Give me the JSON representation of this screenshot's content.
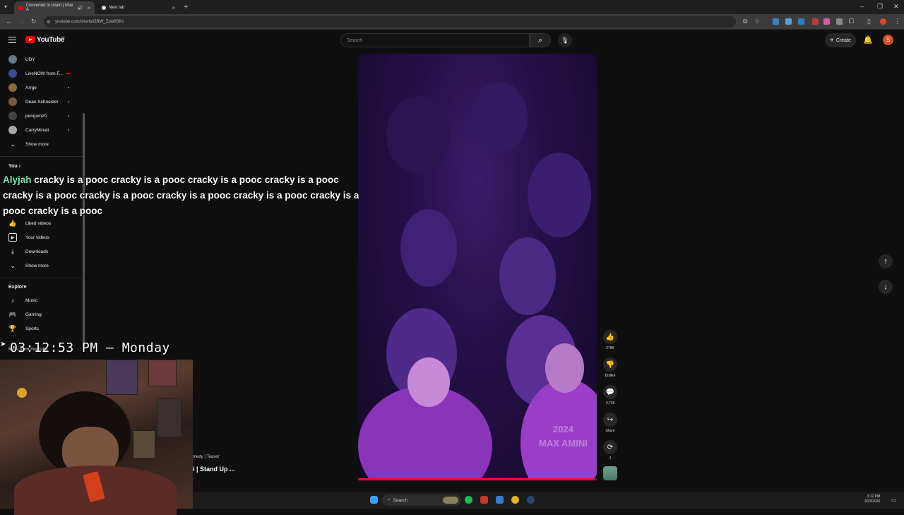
{
  "browser": {
    "tabs": [
      {
        "title": "Converted to Islam | Max A",
        "active": true
      },
      {
        "title": "New tab",
        "active": false
      }
    ],
    "url": "youtube.com/shorts/GBW_Zow0SKs"
  },
  "header": {
    "logo_text": "YouTube",
    "logo_sup": "SO",
    "search_placeholder": "Search",
    "create_label": "Create",
    "avatar_letter": "S"
  },
  "sidebar": {
    "subscriptions": [
      {
        "label": "UDY",
        "live": false,
        "dot": false
      },
      {
        "label": "LiveNOW from F...",
        "live": true,
        "dot": false
      },
      {
        "label": "Arrge",
        "live": false,
        "dot": true
      },
      {
        "label": "Dean Schneider",
        "live": false,
        "dot": true
      },
      {
        "label": "penguinz0",
        "live": false,
        "dot": true
      },
      {
        "label": "CarryMinati",
        "live": false,
        "dot": true
      }
    ],
    "show_more_1": "Show more",
    "you_heading": "You",
    "you_items": [
      {
        "label": "Liked videos",
        "icon": "thumb-up"
      },
      {
        "label": "Your videos",
        "icon": "play"
      },
      {
        "label": "Downloads",
        "icon": "download"
      }
    ],
    "show_more_2": "Show more",
    "explore_heading": "Explore",
    "explore_items": [
      {
        "label": "Music",
        "icon": "music"
      },
      {
        "label": "Gaming",
        "icon": "gaming"
      },
      {
        "label": "Sports",
        "icon": "trophy"
      }
    ],
    "more_heading": "More from YouTube"
  },
  "overlay": {
    "chat_user": "Alyjah",
    "chat_text": " cracky is a pooc cracky is a pooc cracky is a pooc cracky is a pooc cracky is a pooc cracky is a pooc cracky is a pooc cracky is a pooc cracky is a pooc cracky is a pooc",
    "clock": "03:12:53 PM — Monday",
    "teaser_line1": "medy | Teaser",
    "teaser_line2": "i | Stand Up ..."
  },
  "video": {
    "watermark_year": "2024",
    "watermark_name": "MAX AMINI",
    "progress": 0.99
  },
  "actions": {
    "likes": "278K",
    "dislike": "Dislike",
    "comments": "3,736",
    "share": "Share",
    "remix": "2"
  },
  "taskbar": {
    "search": "Search",
    "time": "3:12 PM",
    "date": "3/23/2026"
  },
  "colors": {
    "youtube_red": "#ff0000",
    "avatar": "#d84b2a",
    "chat_user": "#7fe3b0",
    "progress": "#ff0033"
  }
}
